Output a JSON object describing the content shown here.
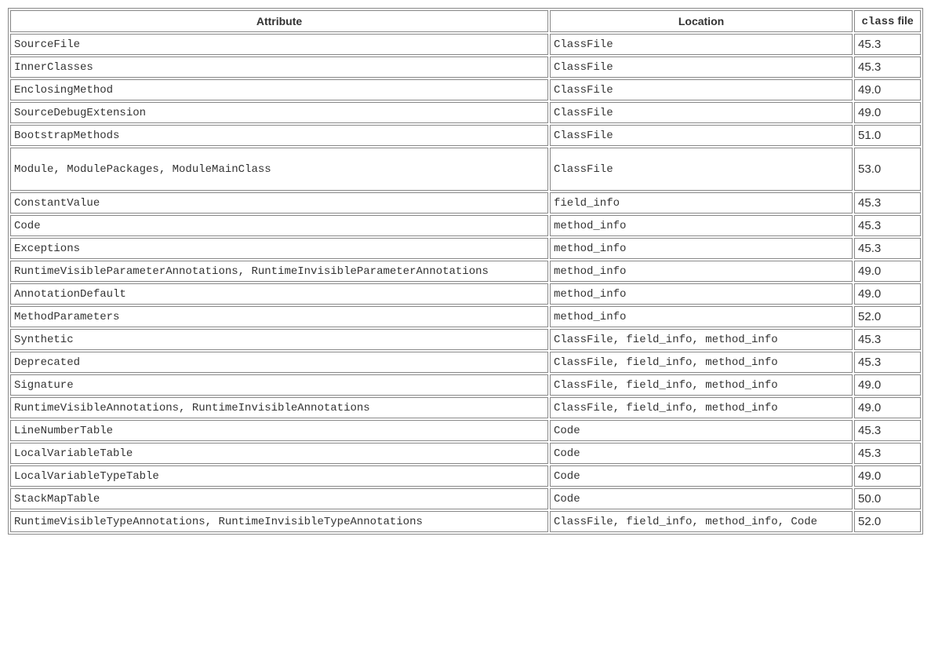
{
  "headers": {
    "attribute": "Attribute",
    "location": "Location",
    "classfile_code": "class",
    "classfile_text": " file"
  },
  "rows": [
    {
      "attribute": "SourceFile",
      "location": "ClassFile",
      "version": "45.3",
      "tall": false
    },
    {
      "attribute": "InnerClasses",
      "location": "ClassFile",
      "version": "45.3",
      "tall": false
    },
    {
      "attribute": "EnclosingMethod",
      "location": "ClassFile",
      "version": "49.0",
      "tall": false
    },
    {
      "attribute": "SourceDebugExtension",
      "location": "ClassFile",
      "version": "49.0",
      "tall": false
    },
    {
      "attribute": "BootstrapMethods",
      "location": "ClassFile",
      "version": "51.0",
      "tall": false
    },
    {
      "attribute": "Module, ModulePackages, ModuleMainClass",
      "location": "ClassFile",
      "version": "53.0",
      "tall": true
    },
    {
      "attribute": "ConstantValue",
      "location": "field_info",
      "version": "45.3",
      "tall": false
    },
    {
      "attribute": "Code",
      "location": "method_info",
      "version": "45.3",
      "tall": false
    },
    {
      "attribute": "Exceptions",
      "location": "method_info",
      "version": "45.3",
      "tall": false
    },
    {
      "attribute": "RuntimeVisibleParameterAnnotations, RuntimeInvisibleParameterAnnotations",
      "location": "method_info",
      "version": "49.0",
      "tall": false
    },
    {
      "attribute": "AnnotationDefault",
      "location": "method_info",
      "version": "49.0",
      "tall": false
    },
    {
      "attribute": "MethodParameters",
      "location": "method_info",
      "version": "52.0",
      "tall": false
    },
    {
      "attribute": "Synthetic",
      "location": "ClassFile, field_info, method_info",
      "version": "45.3",
      "tall": false
    },
    {
      "attribute": "Deprecated",
      "location": "ClassFile, field_info, method_info",
      "version": "45.3",
      "tall": false
    },
    {
      "attribute": "Signature",
      "location": "ClassFile, field_info, method_info",
      "version": "49.0",
      "tall": false
    },
    {
      "attribute": "RuntimeVisibleAnnotations, RuntimeInvisibleAnnotations",
      "location": "ClassFile, field_info, method_info",
      "version": "49.0",
      "tall": false
    },
    {
      "attribute": "LineNumberTable",
      "location": "Code",
      "version": "45.3",
      "tall": false
    },
    {
      "attribute": "LocalVariableTable",
      "location": "Code",
      "version": "45.3",
      "tall": false
    },
    {
      "attribute": "LocalVariableTypeTable",
      "location": "Code",
      "version": "49.0",
      "tall": false
    },
    {
      "attribute": "StackMapTable",
      "location": "Code",
      "version": "50.0",
      "tall": false
    },
    {
      "attribute": "RuntimeVisibleTypeAnnotations, RuntimeInvisibleTypeAnnotations",
      "location": "ClassFile, field_info, method_info, Code",
      "version": "52.0",
      "tall": false
    }
  ]
}
